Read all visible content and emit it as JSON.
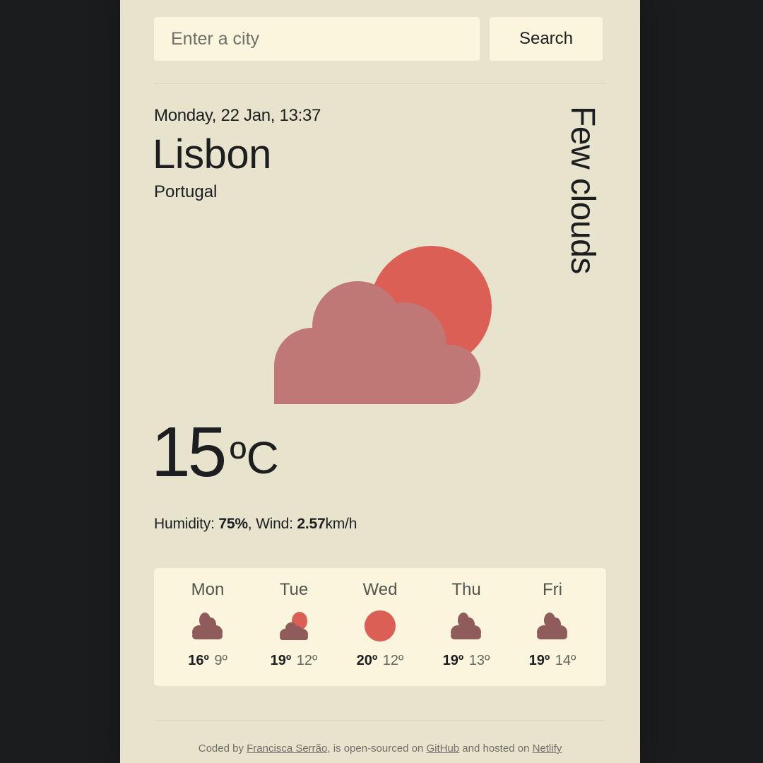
{
  "search": {
    "placeholder": "Enter a city",
    "value": "",
    "button_label": "Search"
  },
  "current": {
    "datetime": "Monday, 22 Jan, 13:37",
    "city": "Lisbon",
    "country": "Portugal",
    "description": "Few clouds",
    "icon": "few-clouds",
    "temperature": "15",
    "unit": "ºC",
    "humidity_label": "Humidity: ",
    "humidity_value": "75%",
    "wind_label": ", Wind: ",
    "wind_value": "2.57",
    "wind_unit": "km/h"
  },
  "forecast": [
    {
      "day": "Mon",
      "icon": "broken-clouds",
      "max": "16º",
      "min": "9º"
    },
    {
      "day": "Tue",
      "icon": "few-clouds",
      "max": "19º",
      "min": "12º"
    },
    {
      "day": "Wed",
      "icon": "clear-sky",
      "max": "20º",
      "min": "12º"
    },
    {
      "day": "Thu",
      "icon": "broken-clouds",
      "max": "19º",
      "min": "13º"
    },
    {
      "day": "Fri",
      "icon": "broken-clouds",
      "max": "19º",
      "min": "14º"
    }
  ],
  "footer": {
    "text_1": "Coded by ",
    "author_link": "Francisca Serrão",
    "text_2": ", is open-sourced on ",
    "github_link": "GitHub",
    "text_3": " and hosted on ",
    "netlify_link": "Netlify"
  },
  "colors": {
    "background": "#1b1c1e",
    "card": "#e8e3cd",
    "panel": "#fbf5dd",
    "sun": "#dc5f55",
    "cloud_main": "#bf7876",
    "cloud_forecast": "#8f5b5b",
    "text": "#1d1e20"
  }
}
